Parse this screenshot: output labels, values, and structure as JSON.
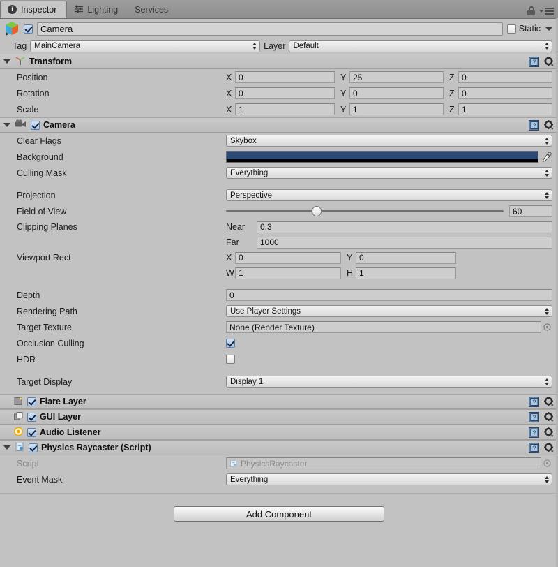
{
  "window": {
    "tabs": [
      {
        "label": "Inspector",
        "icon": "info-icon",
        "active": true
      },
      {
        "label": "Lighting",
        "icon": "sliders-icon",
        "active": false
      },
      {
        "label": "Services",
        "icon": "none",
        "active": false
      }
    ],
    "lock_icon": "lock-icon",
    "menu_icon": "hamburger-menu-icon"
  },
  "object_header": {
    "prefab_icon": "gameobject-cube-icon",
    "enabled": true,
    "name": "Camera",
    "static_label": "Static",
    "static_checked": false
  },
  "tag_layer": {
    "tag_label": "Tag",
    "tag_value": "MainCamera",
    "layer_label": "Layer",
    "layer_value": "Default"
  },
  "transform": {
    "title": "Transform",
    "icon": "transform-axis-icon",
    "expanded": true,
    "rows": [
      {
        "label": "Position",
        "x": "0",
        "y": "25",
        "z": "0"
      },
      {
        "label": "Rotation",
        "x": "0",
        "y": "0",
        "z": "0"
      },
      {
        "label": "Scale",
        "x": "1",
        "y": "1",
        "z": "1"
      }
    ],
    "axis_labels": [
      "X",
      "Y",
      "Z"
    ]
  },
  "camera": {
    "title": "Camera",
    "icon": "camera-icon",
    "enabled": true,
    "expanded": true,
    "clear_flags": {
      "label": "Clear Flags",
      "value": "Skybox"
    },
    "background": {
      "label": "Background",
      "color": "#2d4a77",
      "alpha_color": "#000000",
      "picker_icon": "eyedropper-icon"
    },
    "culling_mask": {
      "label": "Culling Mask",
      "value": "Everything"
    },
    "projection": {
      "label": "Projection",
      "value": "Perspective"
    },
    "field_of_view": {
      "label": "Field of View",
      "value": "60",
      "slider_percent": 31
    },
    "clipping_planes": {
      "label": "Clipping Planes",
      "near_label": "Near",
      "near_value": "0.3",
      "far_label": "Far",
      "far_value": "1000"
    },
    "viewport_rect": {
      "label": "Viewport Rect",
      "x_label": "X",
      "x_value": "0",
      "y_label": "Y",
      "y_value": "0",
      "w_label": "W",
      "w_value": "1",
      "h_label": "H",
      "h_value": "1"
    },
    "depth": {
      "label": "Depth",
      "value": "0"
    },
    "rendering_path": {
      "label": "Rendering Path",
      "value": "Use Player Settings"
    },
    "target_texture": {
      "label": "Target Texture",
      "value": "None (Render Texture)",
      "picker_icon": "object-picker-icon"
    },
    "occlusion_culling": {
      "label": "Occlusion Culling",
      "checked": true
    },
    "hdr": {
      "label": "HDR",
      "checked": false
    },
    "target_display": {
      "label": "Target Display",
      "value": "Display 1"
    }
  },
  "components": [
    {
      "title": "Flare Layer",
      "icon": "flare-layer-icon",
      "enabled": true,
      "expandable": false
    },
    {
      "title": "GUI Layer",
      "icon": "gui-layer-icon",
      "enabled": true,
      "expandable": false
    },
    {
      "title": "Audio Listener",
      "icon": "audio-listener-icon",
      "enabled": true,
      "expandable": false
    }
  ],
  "physics_raycaster": {
    "title": "Physics Raycaster (Script)",
    "icon": "script-icon",
    "enabled": true,
    "expanded": true,
    "script": {
      "label": "Script",
      "value": "PhysicsRaycaster",
      "icon": "script-file-icon",
      "picker_icon": "object-picker-icon"
    },
    "event_mask": {
      "label": "Event Mask",
      "value": "Everything"
    }
  },
  "footer": {
    "add_component_label": "Add Component"
  }
}
